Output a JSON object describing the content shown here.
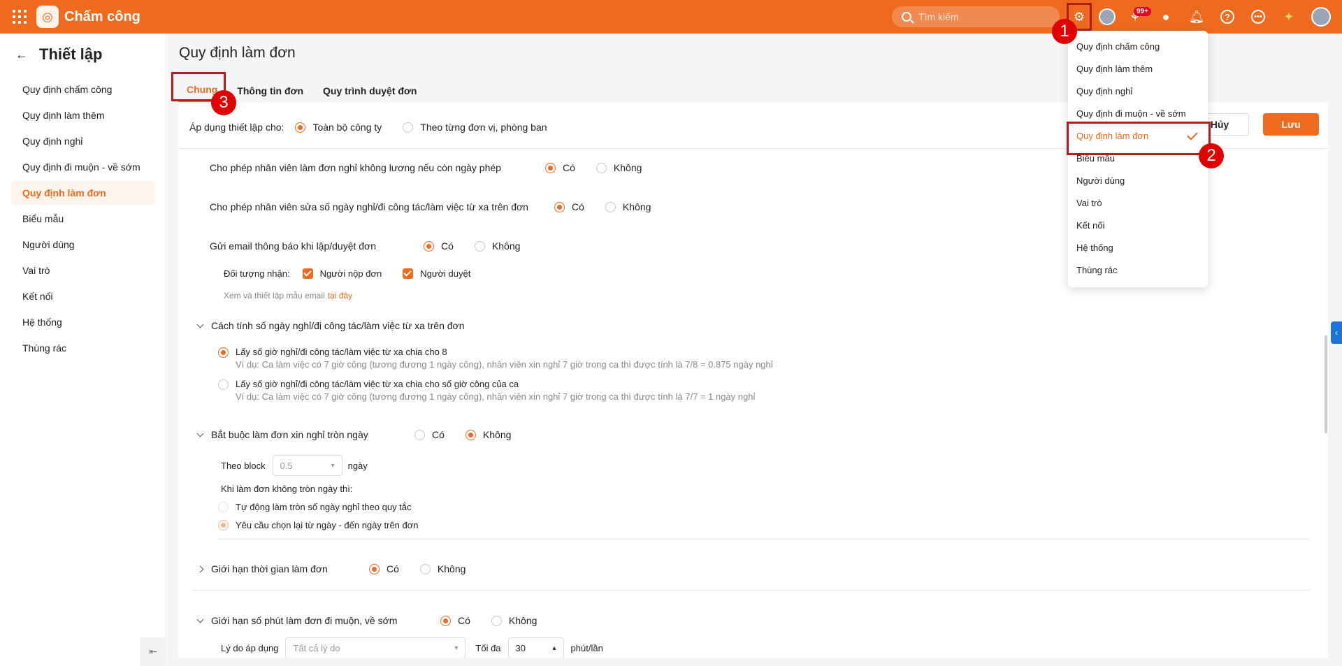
{
  "app": {
    "title": "Chấm công",
    "search_placeholder": "Tìm kiếm",
    "notif_badge": "99+"
  },
  "sidebar": {
    "title": "Thiết lập",
    "items": [
      {
        "label": "Quy định chấm công"
      },
      {
        "label": "Quy định làm thêm"
      },
      {
        "label": "Quy định nghỉ"
      },
      {
        "label": "Quy định đi muộn - về sớm"
      },
      {
        "label": "Quy định làm đơn",
        "active": true
      },
      {
        "label": "Biểu mẫu"
      },
      {
        "label": "Người dùng"
      },
      {
        "label": "Vai trò"
      },
      {
        "label": "Kết nối"
      },
      {
        "label": "Hệ thống"
      },
      {
        "label": "Thùng rác"
      }
    ]
  },
  "main": {
    "page_title": "Quy định làm đơn",
    "tabs": [
      "Chung",
      "Thông tin đơn",
      "Quy trình duyệt đơn"
    ],
    "cancel_label": "Hủy",
    "save_label": "Lưu",
    "apply": {
      "label": "Áp dụng thiết lập cho:",
      "opt1": "Toàn bộ công ty",
      "opt2": "Theo từng đơn vị, phòng ban"
    },
    "yes": "Có",
    "no": "Không",
    "s1": "Cho phép nhân viên làm đơn nghỉ không lương nếu còn ngày phép",
    "s2": "Cho phép nhân viên sửa số ngày nghỉ/đi công tác/làm việc từ xa trên đơn",
    "s3": "Gửi email thông báo khi lập/duyệt đơn",
    "recipients_label": "Đối tượng nhận:",
    "recipient1": "Người nộp đơn",
    "recipient2": "Người duyệt",
    "email_note": "Xem và thiết lập mẫu email",
    "email_link": "tại đây",
    "calc_title": "Cách tính số ngày nghỉ/đi công tác/làm việc từ xa trên đơn",
    "calc1": "Lấy số giờ nghỉ/đi công tác/làm việc từ xa chia cho 8",
    "calc1_ex": "Ví dụ: Ca làm việc có 7 giờ công (tương đương 1 ngày công), nhân viên xin nghỉ 7 giờ trong ca thì được tính là 7/8 = 0.875 ngày nghỉ",
    "calc2": "Lấy số giờ nghỉ/đi công tác/làm việc từ xa chia cho số giờ công của ca",
    "calc2_ex": "Ví dụ: Ca làm việc có 7 giờ công (tương đương 1 ngày công), nhân viên xin nghỉ 7 giờ trong ca thì được tính là 7/7 = 1 ngày nghỉ",
    "full_day_title": "Bắt buộc làm đơn xin nghỉ tròn ngày",
    "block_label": "Theo block",
    "block_value": "0.5",
    "block_unit": "ngày",
    "not_full_label": "Khi làm đơn không tròn ngày thì:",
    "nf1": "Tự động làm tròn số ngày nghỉ theo quy tắc",
    "nf2": "Yêu cầu chọn lại từ ngày - đến ngày trên đơn",
    "time_limit_title": "Giới hạn thời gian làm đơn",
    "late_limit_title": "Giới hạn số phút làm đơn đi muộn, về sớm",
    "reason_label": "Lý do áp dụng",
    "reason_placeholder": "Tất cả lý do",
    "max_label": "Tối đa",
    "max_value": "30",
    "max_unit": "phút/lần"
  },
  "dropdown": {
    "items": [
      {
        "label": "Quy định chấm công"
      },
      {
        "label": "Quy định làm thêm"
      },
      {
        "label": "Quy định nghỉ"
      },
      {
        "label": "Quy định đi muộn - về sớm"
      },
      {
        "label": "Quy định làm đơn",
        "active": true
      },
      {
        "label": "Biểu mẫu"
      },
      {
        "label": "Người dùng"
      },
      {
        "label": "Vai trò"
      },
      {
        "label": "Kết nối"
      },
      {
        "label": "Hệ thống"
      },
      {
        "label": "Thùng rác"
      }
    ]
  },
  "annotations": [
    "1",
    "2",
    "3"
  ],
  "colors": {
    "brand": "#ee6a1f",
    "annotation": "#e00000",
    "highlight_box": "#b71c1c"
  },
  "icons": [
    "apps-grid-icon",
    "fingerprint-logo-icon",
    "search-icon",
    "gear-icon",
    "avatar-icon",
    "chart-icon",
    "chat-icon",
    "bell-icon",
    "help-icon",
    "more-icon",
    "gift-icon"
  ]
}
